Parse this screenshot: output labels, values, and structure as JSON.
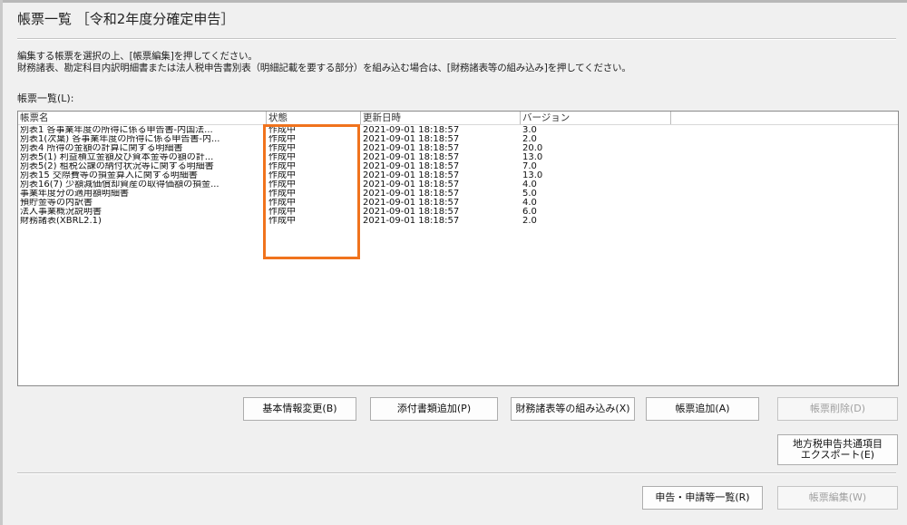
{
  "title": "帳票一覧 ［令和2年度分確定申告］",
  "instructions": {
    "line1": "編集する帳票を選択の上、[帳票編集]を押してください。",
    "line2": "財務諸表、勘定科目内訳明細書または法人税申告書別表（明細記載を要する部分）を組み込む場合は、[財務諸表等の組み込み]を押してください。"
  },
  "list_label": "帳票一覧(L):",
  "table": {
    "columns": [
      "帳票名",
      "状態",
      "更新日時",
      "バージョン",
      ""
    ],
    "rows": [
      [
        "別表1 各事業年度の所得に係る申告書-内国法...",
        "作成中",
        "2021-09-01 18:18:57",
        "3.0"
      ],
      [
        "別表1(次葉) 各事業年度の所得に係る申告書-内...",
        "作成中",
        "2021-09-01 18:18:57",
        "2.0"
      ],
      [
        "別表4 所得の金額の計算に関する明細書",
        "作成中",
        "2021-09-01 18:18:57",
        "20.0"
      ],
      [
        "別表5(1) 利益積立金額及び資本金等の額の計...",
        "作成中",
        "2021-09-01 18:18:57",
        "13.0"
      ],
      [
        "別表5(2) 租税公課の納付状況等に関する明細書",
        "作成中",
        "2021-09-01 18:18:57",
        "7.0"
      ],
      [
        "別表15 交際費等の損金算入に関する明細書",
        "作成中",
        "2021-09-01 18:18:57",
        "13.0"
      ],
      [
        "別表16(7) 少額減価償却資産の取得価額の損金...",
        "作成中",
        "2021-09-01 18:18:57",
        "4.0"
      ],
      [
        "事業年度分の適用額明細書",
        "作成中",
        "2021-09-01 18:18:57",
        "5.0"
      ],
      [
        "預貯金等の内訳書",
        "作成中",
        "2021-09-01 18:18:57",
        "4.0"
      ],
      [
        "法人事業概況説明書",
        "作成中",
        "2021-09-01 18:18:57",
        "6.0"
      ],
      [
        "財務諸表(XBRL2.1)",
        "作成中",
        "2021-09-01 18:18:57",
        "2.0"
      ]
    ]
  },
  "buttons": {
    "basic_info": "基本情報変更(B)",
    "add_attachment": "添付書類追加(P)",
    "incorporate_fs": "財務諸表等の組み込み(X)",
    "add_form": "帳票追加(A)",
    "delete_form": "帳票削除(D)",
    "export_line1": "地方税申告共通項目",
    "export_line2": "エクスポート(E)",
    "filing_list": "申告・申請等一覧(R)",
    "edit_form": "帳票編集(W)"
  },
  "highlight_color": "#f0731d"
}
